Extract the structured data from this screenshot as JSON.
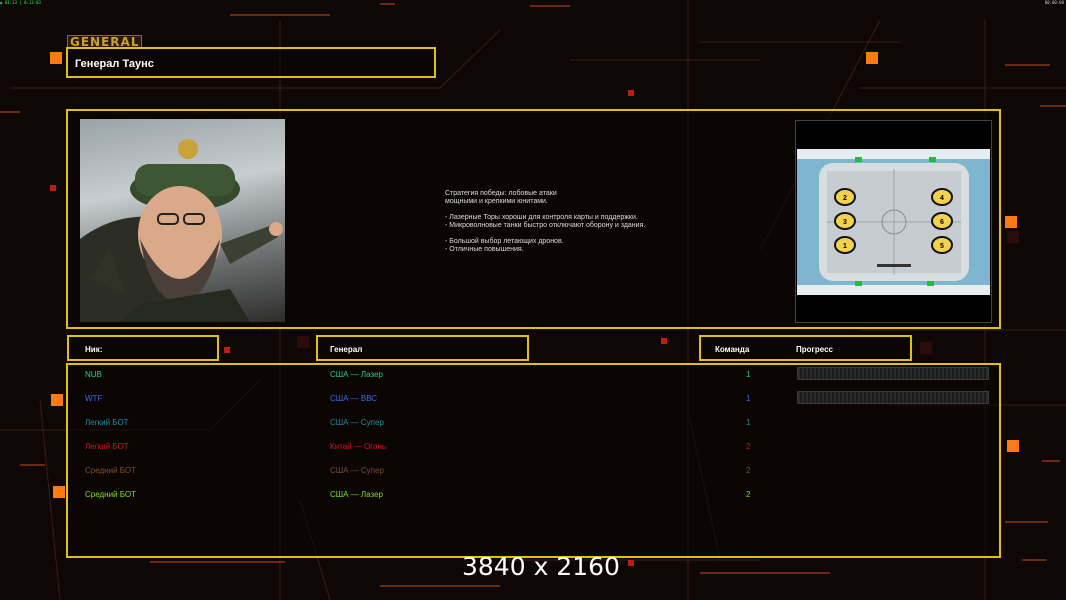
{
  "top_left_stats": "◉ 01:13 | 0:13:03",
  "top_right_clock": "00:00:00",
  "logo": "GENERAL",
  "general_name": "Генерал Таунс",
  "description": "Стратегия победы: лобовые атаки\nмощными и крепкими юнитами.\n\n- Лазерные Торы хороши для контроля карты и поддержки.\n- Микроволновые танки быстро отключают оборону и здания.\n\n- Большой выбор летающих дронов.\n- Отличные повышения.",
  "headers": {
    "nick": "Ник:",
    "general": "Генерал",
    "team": "Команда",
    "progress": "Прогресс"
  },
  "players": [
    {
      "nick": "NUB",
      "general": "США — Лазер",
      "team": "1",
      "color": "#1fd17a",
      "progress": true
    },
    {
      "nick": "WTF",
      "general": "США — ВВС",
      "team": "1",
      "color": "#3b6cf0",
      "progress": true
    },
    {
      "nick": "Легкий БОТ",
      "general": "США — Супер",
      "team": "1",
      "color": "#1b8fa3",
      "progress": false
    },
    {
      "nick": "Легкий БОТ",
      "general": "Китай — Огонь",
      "team": "2",
      "color": "#d7131b",
      "progress": false
    },
    {
      "nick": "Средний БОТ",
      "general": "США — Супер",
      "team": "2",
      "color": "#7b4f2f",
      "progress": false
    },
    {
      "nick": "Средний БОТ",
      "general": "США — Лазер",
      "team": "2",
      "color": "#7be01f",
      "progress": false
    }
  ],
  "map_slots": [
    "2",
    "4",
    "3",
    "6",
    "1",
    "5"
  ],
  "watermark": "3840 x 2160"
}
